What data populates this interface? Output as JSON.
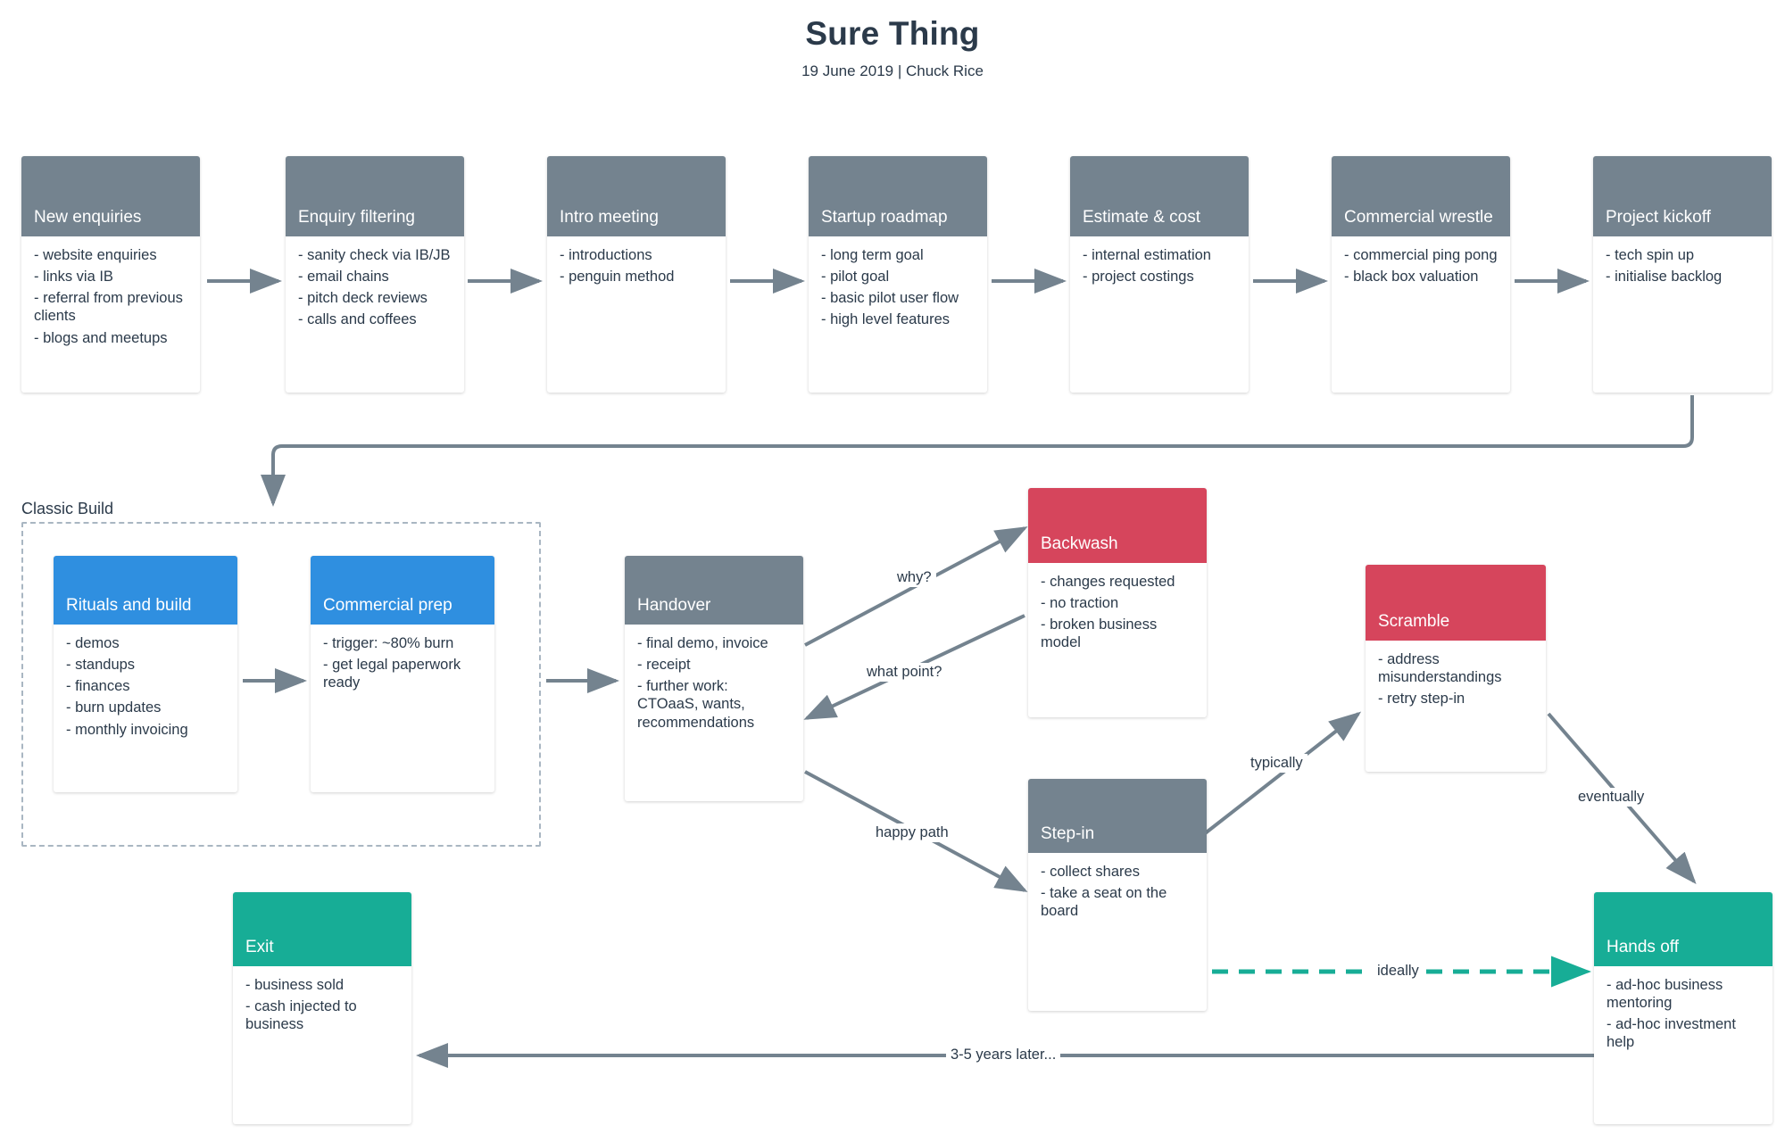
{
  "header": {
    "title": "Sure Thing",
    "subtitle": "19 June 2019 | Chuck Rice"
  },
  "groups": [
    {
      "id": "classic-build",
      "label": "Classic Build"
    }
  ],
  "palette": {
    "gray": "#74838f",
    "blue": "#2f8fe0",
    "red": "#d6455c",
    "teal": "#17ad96",
    "text": "#2b3a4a",
    "arrow": "#74838f",
    "dashed_arrow": "#17ad96",
    "group_border": "#a9b6c2"
  },
  "cards": [
    {
      "id": "new-enquiries",
      "title": "New enquiries",
      "color": "gray",
      "items": [
        "- website enquiries",
        "- links via IB",
        "- referral from previous clients",
        "- blogs and meetups"
      ]
    },
    {
      "id": "enquiry-filtering",
      "title": "Enquiry filtering",
      "color": "gray",
      "items": [
        "- sanity check via IB/JB",
        "- email chains",
        "- pitch deck reviews",
        "- calls and coffees"
      ]
    },
    {
      "id": "intro-meeting",
      "title": "Intro meeting",
      "color": "gray",
      "items": [
        "- introductions",
        "- penguin method"
      ]
    },
    {
      "id": "startup-roadmap",
      "title": "Startup roadmap",
      "color": "gray",
      "items": [
        "- long term goal",
        "- pilot goal",
        "- basic pilot user flow",
        "- high level features"
      ]
    },
    {
      "id": "estimate-cost",
      "title": "Estimate & cost",
      "color": "gray",
      "items": [
        "- internal estimation",
        "- project costings"
      ]
    },
    {
      "id": "commercial-wrestle",
      "title": "Commercial wrestle",
      "color": "gray",
      "items": [
        "- commercial ping pong",
        "- black box valuation"
      ]
    },
    {
      "id": "project-kickoff",
      "title": "Project kickoff",
      "color": "gray",
      "items": [
        "- tech spin up",
        "- initialise backlog"
      ]
    },
    {
      "id": "rituals-and-build",
      "title": "Rituals and build",
      "color": "blue",
      "items": [
        "- demos",
        "- standups",
        "- finances",
        "- burn updates",
        "- monthly invoicing"
      ]
    },
    {
      "id": "commercial-prep",
      "title": "Commercial prep",
      "color": "blue",
      "items": [
        "- trigger: ~80% burn",
        "- get legal paperwork ready"
      ]
    },
    {
      "id": "handover",
      "title": "Handover",
      "color": "gray",
      "items": [
        "- final demo, invoice",
        "- receipt",
        "- further work: CTOaaS, wants, recommendations"
      ]
    },
    {
      "id": "backwash",
      "title": "Backwash",
      "color": "red",
      "items": [
        "- changes requested",
        "- no traction",
        "- broken business model"
      ]
    },
    {
      "id": "scramble",
      "title": "Scramble",
      "color": "red",
      "items": [
        "- address misunderstandings",
        "- retry step-in"
      ]
    },
    {
      "id": "step-in",
      "title": "Step-in",
      "color": "gray",
      "items": [
        "- collect shares",
        "- take a seat on the board"
      ]
    },
    {
      "id": "hands-off",
      "title": "Hands off",
      "color": "teal",
      "items": [
        "- ad-hoc business mentoring",
        "- ad-hoc investment help"
      ]
    },
    {
      "id": "exit",
      "title": "Exit",
      "color": "teal",
      "items": [
        "- business sold",
        "- cash injected to business"
      ]
    }
  ],
  "edge_labels": [
    {
      "id": "why",
      "text": "why?"
    },
    {
      "id": "what-point",
      "text": "what point?"
    },
    {
      "id": "happy-path",
      "text": "happy path"
    },
    {
      "id": "typically",
      "text": "typically"
    },
    {
      "id": "eventually",
      "text": "eventually"
    },
    {
      "id": "ideally",
      "text": "ideally"
    },
    {
      "id": "years-later",
      "text": "3-5 years later..."
    }
  ]
}
